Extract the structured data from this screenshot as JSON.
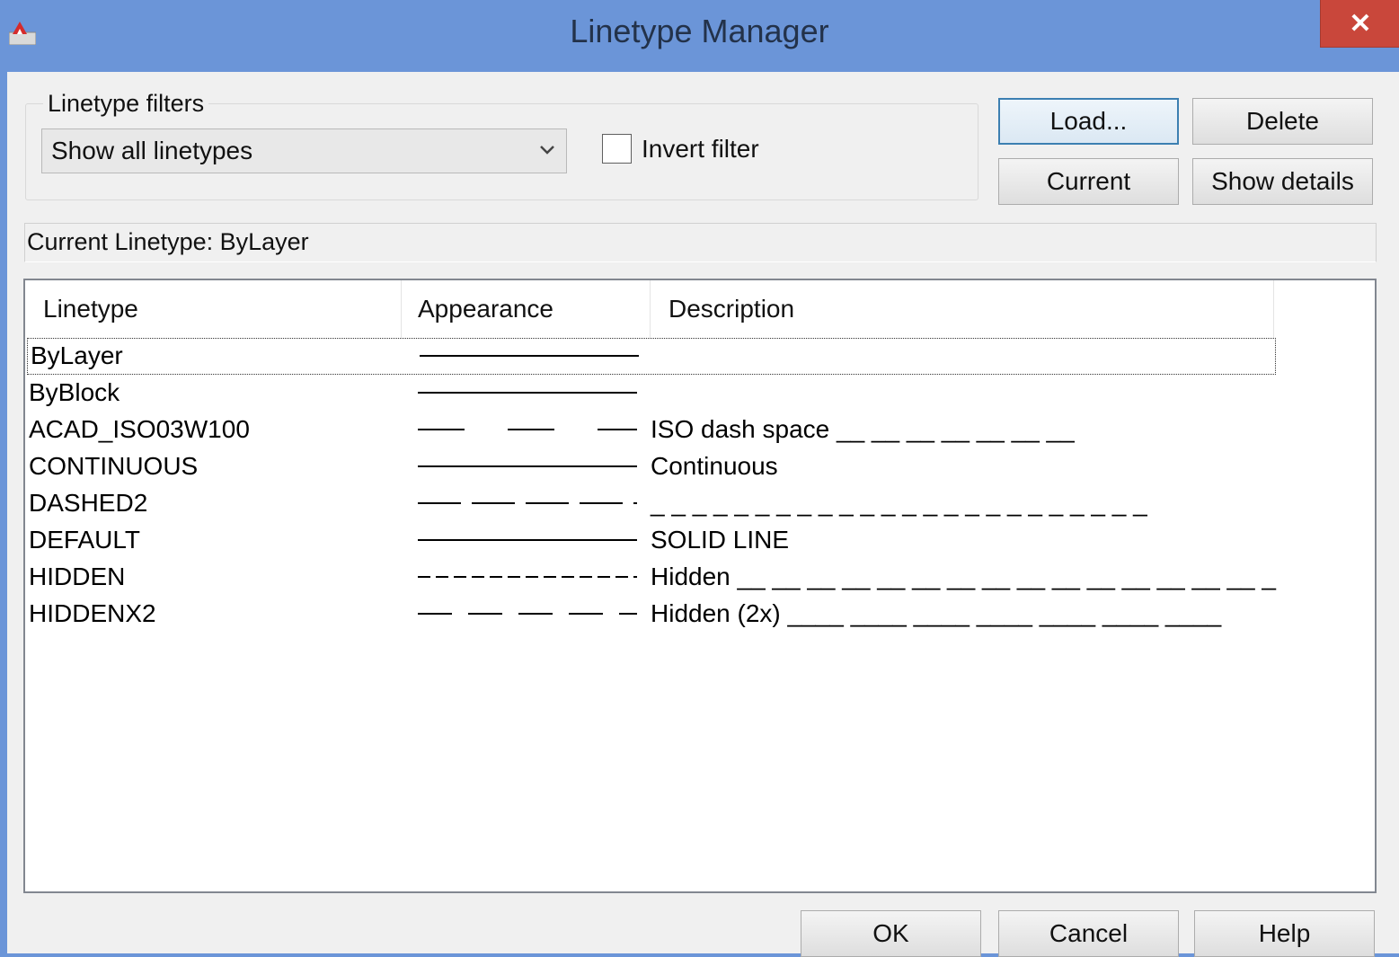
{
  "window": {
    "title": "Linetype Manager",
    "close_glyph": "✕"
  },
  "filters": {
    "group_label": "Linetype filters",
    "selected": "Show all linetypes",
    "invert_label": "Invert filter",
    "invert_checked": false
  },
  "buttons": {
    "load": "Load...",
    "delete": "Delete",
    "current": "Current",
    "show_details": "Show details",
    "ok": "OK",
    "cancel": "Cancel",
    "help": "Help"
  },
  "current_linetype": "Current Linetype:  ByLayer",
  "table": {
    "columns": [
      "Linetype",
      "Appearance",
      "Description"
    ],
    "rows": [
      {
        "name": "ByLayer",
        "pattern": "solid",
        "description": ""
      },
      {
        "name": "ByBlock",
        "pattern": "solid",
        "description": ""
      },
      {
        "name": "ACAD_ISO03W100",
        "pattern": "iso03w100",
        "description": "ISO dash space __ __ __ __ __ __ __"
      },
      {
        "name": "CONTINUOUS",
        "pattern": "solid",
        "description": "Continuous"
      },
      {
        "name": "DASHED2",
        "pattern": "dashed2",
        "description": "_ _ _ _ _ _ _ _ _ _ _ _ _ _ _ _ _ _ _ _ _ _ _ _"
      },
      {
        "name": "DEFAULT",
        "pattern": "solid",
        "description": "SOLID LINE"
      },
      {
        "name": "HIDDEN",
        "pattern": "hidden",
        "description": "Hidden __ __ __ __ __ __ __ __ __ __ __ __ __ __ __ _"
      },
      {
        "name": "HIDDENX2",
        "pattern": "hiddenx2",
        "description": "Hidden (2x) ____ ____ ____ ____ ____ ____ ____"
      }
    ]
  },
  "colors": {
    "titlebar": "#6b95d8",
    "close": "#c9473b",
    "focus_border": "#3c7fb1"
  }
}
